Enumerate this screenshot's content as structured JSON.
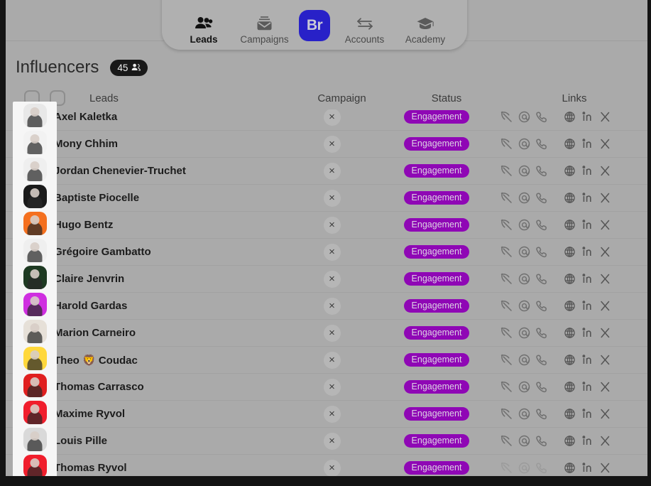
{
  "nav": {
    "items": [
      {
        "label": "Leads",
        "icon": "people-icon",
        "active": true
      },
      {
        "label": "Campaigns",
        "icon": "envelope-icon",
        "active": false
      },
      {
        "label": "Accounts",
        "icon": "swap-arrows-icon",
        "active": false
      },
      {
        "label": "Academy",
        "icon": "graduation-cap-icon",
        "active": false
      }
    ],
    "brand": {
      "label": "Br",
      "color": "#2821c8",
      "text_color": "#c9c9d6"
    }
  },
  "header": {
    "title": "Influencers",
    "count": "45",
    "count_icon": "people-icon",
    "badge_bg": "#191919"
  },
  "table": {
    "columns": [
      {
        "key": "leads",
        "label": "Leads"
      },
      {
        "key": "campaign",
        "label": "Campaign"
      },
      {
        "key": "status",
        "label": "Status"
      },
      {
        "key": "links",
        "label": "Links"
      }
    ],
    "select_all_checked": false,
    "link_icons": [
      "pickaxe-icon",
      "email-at-icon",
      "phone-icon",
      "globe-icon",
      "linkedin-icon",
      "twitter-x-icon"
    ],
    "campaign_action_icon": "close-x-icon",
    "status_badge_color": "#8f07b5",
    "rows": [
      {
        "name": "Axel Kaletka",
        "campaign": "×",
        "status": "Engagement",
        "avatar_bg": "#e8e8e8",
        "avatar_accent": "#ffe21f"
      },
      {
        "name": "Mony Chhim",
        "campaign": "×",
        "status": "Engagement",
        "avatar_bg": "#f2f2f2",
        "avatar_accent": "#ffe21f"
      },
      {
        "name": "Jordan Chenevier-Truchet",
        "campaign": "×",
        "status": "Engagement",
        "avatar_bg": "#efefef",
        "avatar_accent": "#d8d8d8"
      },
      {
        "name": "Baptiste Piocelle",
        "campaign": "×",
        "status": "Engagement",
        "avatar_bg": "#1a1a1a",
        "avatar_accent": "#f58220"
      },
      {
        "name": "Hugo Bentz",
        "campaign": "×",
        "status": "Engagement",
        "avatar_bg": "#f4701f",
        "avatar_accent": "#f4701f"
      },
      {
        "name": "Grégoire Gambatto",
        "campaign": "×",
        "status": "Engagement",
        "avatar_bg": "#efefef",
        "avatar_accent": "#1a1a1a"
      },
      {
        "name": "Claire Jenvrin",
        "campaign": "×",
        "status": "Engagement",
        "avatar_bg": "#1e3a22",
        "avatar_accent": "#2f6b36"
      },
      {
        "name": "Harold Gardas",
        "campaign": "×",
        "status": "Engagement",
        "avatar_bg": "#cf2fe0",
        "avatar_accent": "#cf2fe0"
      },
      {
        "name": "Marion Carneiro",
        "campaign": "×",
        "status": "Engagement",
        "avatar_bg": "#e6e0d8",
        "avatar_accent": "#caa36a"
      },
      {
        "name": "Theo 🦁 Coudac",
        "campaign": "×",
        "status": "Engagement",
        "avatar_bg": "#ffd83b",
        "avatar_accent": "#ffd83b"
      },
      {
        "name": "Thomas Carrasco",
        "campaign": "×",
        "status": "Engagement",
        "avatar_bg": "#e02020",
        "avatar_accent": "#e02020"
      },
      {
        "name": "Maxime Ryvol",
        "campaign": "×",
        "status": "Engagement",
        "avatar_bg": "#f01e2c",
        "avatar_accent": "#f01e2c"
      },
      {
        "name": "Louis Pille",
        "campaign": "×",
        "status": "Engagement",
        "avatar_bg": "#d9d9d9",
        "avatar_accent": "#8a8a8a"
      },
      {
        "name": "Thomas Ryvol",
        "campaign": "×",
        "status": "Engagement",
        "avatar_bg": "#f01e2c",
        "avatar_accent": "#f01e2c"
      }
    ]
  }
}
